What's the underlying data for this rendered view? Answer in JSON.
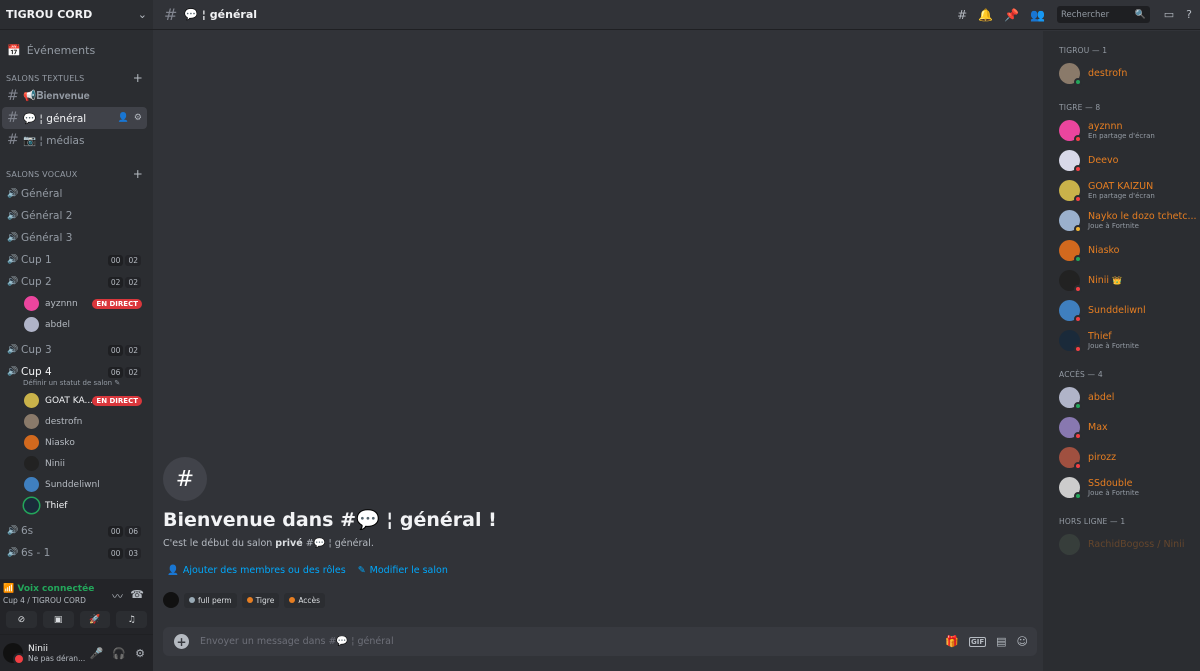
{
  "server": {
    "name": "TIGROU CORD"
  },
  "sidebar": {
    "events_label": "Événements",
    "text_category": "SALONS TEXTUELS",
    "text_channels": [
      {
        "label": "📢𝐁𝐢𝐞𝐧𝐯𝐞𝐧𝐮𝐞"
      },
      {
        "label": "💬 ¦ général"
      },
      {
        "label": "📷 ¦ médias"
      }
    ],
    "voice_category": "SALONS VOCAUX",
    "voice_channels": {
      "general": "Général",
      "general2": "Général 2",
      "general3": "Général 3",
      "cup1": {
        "label": "Cup 1",
        "c1": "00",
        "c2": "02"
      },
      "cup2": {
        "label": "Cup 2",
        "c1": "02",
        "c2": "02"
      },
      "cup3": {
        "label": "Cup 3",
        "c1": "00",
        "c2": "02"
      },
      "cup4": {
        "label": "Cup 4",
        "c1": "06",
        "c2": "02",
        "status": "Définir un statut de salon"
      },
      "six": {
        "label": "6s",
        "c1": "00",
        "c2": "06"
      },
      "sixone": {
        "label": "6s - 1",
        "c1": "00",
        "c2": "03"
      }
    },
    "cup2_users": [
      {
        "name": "ayznnn",
        "live": "EN DIRECT"
      },
      {
        "name": "abdel"
      }
    ],
    "cup4_users": [
      {
        "name": "GOAT KA...",
        "live": "EN DIRECT"
      },
      {
        "name": "destrofn"
      },
      {
        "name": "Niasko"
      },
      {
        "name": "Ninii"
      },
      {
        "name": "Sunddeliwnl"
      },
      {
        "name": "Thief"
      }
    ]
  },
  "voice": {
    "title": "Voix connectée",
    "subtitle": "Cup 4 / TIGROU CORD"
  },
  "user": {
    "name": "Ninii",
    "status": "Ne pas déran..."
  },
  "header": {
    "channel": "💬 ¦ général",
    "search_placeholder": "Rechercher"
  },
  "welcome": {
    "title": "Bienvenue dans #💬 ¦ général !",
    "sub_prefix": "C'est le début du salon ",
    "sub_bold": "privé",
    "sub_suffix": " #💬 ¦ général.",
    "add_members": "Ajouter des membres ou des rôles",
    "edit_channel": "Modifier le salon",
    "roles": [
      {
        "name": "full perm",
        "color": "#99aab5"
      },
      {
        "name": "Tigre",
        "color": "#e67e22"
      },
      {
        "name": "Accès",
        "color": "#e67e22"
      }
    ]
  },
  "composer": {
    "placeholder": "Envoyer un message dans #💬 ¦ général"
  },
  "members": {
    "categories": [
      {
        "title": "TIGROU — 1",
        "items": [
          {
            "name": "destrofn",
            "status": "online",
            "av": "#8a7a6a"
          }
        ]
      },
      {
        "title": "TIGRE — 8",
        "items": [
          {
            "name": "ayznnn",
            "activity": "En partage d'écran",
            "status": "dnd",
            "av": "#eb459e"
          },
          {
            "name": "Deevo",
            "status": "dnd",
            "av": "#d8d8e8"
          },
          {
            "name": "GOAT KAIZUN",
            "activity": "En partage d'écran",
            "status": "dnd",
            "av": "#c9b24a"
          },
          {
            "name": "Nayko le dozo tchetc...",
            "activity": "Joue à Fortnite",
            "status": "idle",
            "av": "#9ab0cc"
          },
          {
            "name": "Niasko",
            "status": "online",
            "av": "#d2691e"
          },
          {
            "name": "Ninii",
            "crown": "👑",
            "status": "dnd",
            "av": "#222222"
          },
          {
            "name": "Sunddeliwnl",
            "status": "dnd",
            "av": "#3f7fbf"
          },
          {
            "name": "Thief",
            "activity": "Joue à Fortnite",
            "status": "dnd",
            "av": "#1a2a3a"
          }
        ]
      },
      {
        "title": "ACCÈS — 4",
        "items": [
          {
            "name": "abdel",
            "status": "online",
            "av": "#b0b4c8"
          },
          {
            "name": "Max",
            "status": "dnd",
            "av": "#8878b0"
          },
          {
            "name": "pirozz",
            "status": "dnd",
            "av": "#a05040"
          },
          {
            "name": "SSdouble",
            "activity": "Joue à Fortnite",
            "status": "online",
            "av": "#cccccc"
          }
        ]
      },
      {
        "title": "HORS LIGNE — 1",
        "items": [
          {
            "name": "RachidBogoss / Ninii",
            "status": "offline",
            "av": "#556655"
          }
        ]
      }
    ]
  },
  "colors": {
    "online": "#23a55a",
    "dnd": "#f23f43",
    "idle": "#f0b232",
    "accent": "#00a8fc"
  }
}
